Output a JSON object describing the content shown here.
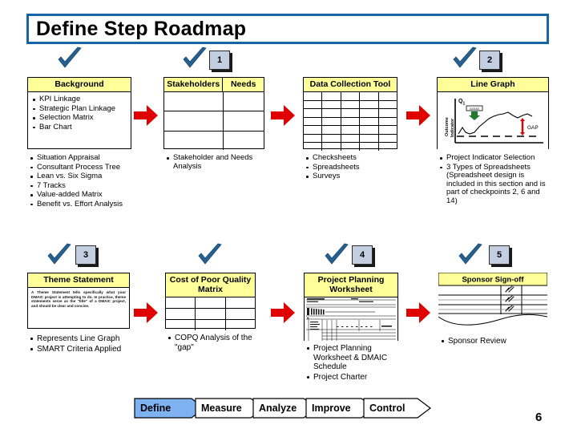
{
  "slide": {
    "title": "Define Step Roadmap",
    "page_number": "6",
    "accent_border": "#1565a8",
    "header_fill": "#ffff99",
    "arrow_color": "#e00000",
    "check_color": "#26608f",
    "numbox_fill": "#c3cfe0",
    "define_highlight": "#7fb2f0"
  },
  "steps": [
    {
      "id": "background",
      "number": "",
      "has_number": false,
      "header": "Background",
      "visual": "bullet-card",
      "card_bullets": [
        "KPI Linkage",
        "Strategic Plan Linkage",
        "Selection Matrix",
        "Bar Chart"
      ],
      "bullets": [
        "Situation Appraisal",
        "Consultant Process Tree",
        "Lean vs. Six Sigma",
        "7 Tracks",
        "Value-added Matrix",
        "Benefit vs. Effort Analysis"
      ]
    },
    {
      "id": "stakeholders",
      "number": "1",
      "has_number": true,
      "header": "Stakeholders",
      "header2": "Needs",
      "visual": "two-col-table",
      "bullets": [
        "Stakeholder and Needs Analysis"
      ]
    },
    {
      "id": "data-collection",
      "number": "",
      "has_number": false,
      "header": "Data Collection Tool",
      "visual": "dense-table",
      "bullets": [
        "Checksheets",
        "Spreadsheets",
        "Surveys"
      ]
    },
    {
      "id": "line-graph",
      "number": "2",
      "has_number": true,
      "header": "Line Graph",
      "visual": "line-graph",
      "graph_labels": {
        "quarter": "Q1",
        "good": "GOOD",
        "yaxis": "Outcome Indicator",
        "gap": "GAP"
      },
      "bullets": [
        "Project Indicator Selection",
        "3 Types of Spreadsheets (Spreadsheet design is included in this section and is part of checkpoints 2, 6 and 14)"
      ]
    },
    {
      "id": "theme-statement",
      "number": "3",
      "has_number": true,
      "header": "Theme Statement",
      "visual": "text-card",
      "body_text": "A Theme Statement tells specifically what your DMAIC project is attempting to do. In practice, theme statements serve as the \"title\" of a DMAIC project, and should be clear and concise.",
      "bullets": [
        "Represents Line Graph",
        "SMART Criteria Applied"
      ]
    },
    {
      "id": "copq",
      "number": "",
      "has_number": false,
      "header": "Cost of Poor Quality Matrix",
      "visual": "three-col-table",
      "bullets": [
        "COPQ Analysis of the \"gap\""
      ]
    },
    {
      "id": "project-planning",
      "number": "4",
      "has_number": true,
      "header": "Project Planning Worksheet",
      "visual": "gantt-mini",
      "bullets": [
        "Project Planning Worksheet & DMAIC Schedule",
        "Project Charter"
      ]
    },
    {
      "id": "sponsor-signoff",
      "number": "5",
      "has_number": true,
      "header": "Sponsor Sign-off",
      "visual": "signoff-table",
      "bullets": [
        "Sponsor Review"
      ]
    }
  ],
  "dmaic": {
    "phases": [
      {
        "label": "Define",
        "active": true
      },
      {
        "label": "Measure",
        "active": false
      },
      {
        "label": "Analyze",
        "active": false
      },
      {
        "label": "Improve",
        "active": false
      },
      {
        "label": "Control",
        "active": false
      }
    ]
  }
}
